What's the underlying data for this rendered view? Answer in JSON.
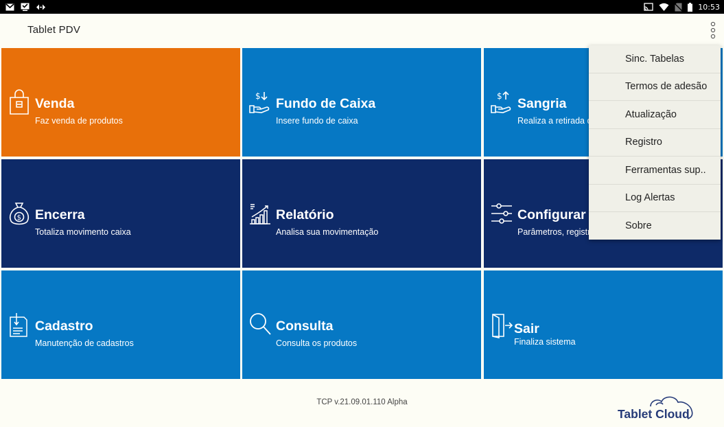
{
  "status_bar": {
    "left_icons": [
      "gmail-icon",
      "download-done-icon",
      "developer-mode-icon"
    ],
    "right_icons": [
      "cast-icon",
      "wifi-icon",
      "no-sim-icon",
      "battery-icon"
    ],
    "time": "10:53"
  },
  "app_bar": {
    "title": "Tablet PDV",
    "overflow_icon": "more-vertical-icon"
  },
  "tiles": [
    {
      "title": "Venda",
      "subtitle": "Faz venda de produtos",
      "color": "#e8700a",
      "icon": "shopping-bag-icon"
    },
    {
      "title": "Fundo de Caixa",
      "subtitle": "Insere fundo de caixa",
      "color": "#0678c4",
      "icon": "hand-money-in-icon"
    },
    {
      "title": "Sangria",
      "subtitle": "Realiza a retirada d",
      "color": "#0678c4",
      "icon": "hand-money-out-icon"
    },
    {
      "title": "Encerra",
      "subtitle": "Totaliza movimento caixa",
      "color": "#0e2a68",
      "icon": "money-bag-icon"
    },
    {
      "title": "Relatório",
      "subtitle": "Analisa sua movimentação",
      "color": "#0e2a68",
      "icon": "bar-chart-icon"
    },
    {
      "title": "Configurar",
      "subtitle": "Parâmetros, registr",
      "color": "#0e2a68",
      "icon": "sliders-icon"
    },
    {
      "title": "Cadastro",
      "subtitle": "Manutenção de cadastros",
      "color": "#0678c4",
      "icon": "document-icon"
    },
    {
      "title": "Consulta",
      "subtitle": "Consulta os produtos",
      "color": "#0678c4",
      "icon": "search-icon"
    },
    {
      "title": "Sair",
      "subtitle": "Finaliza sistema",
      "color": "#0678c4",
      "icon": "exit-door-icon"
    }
  ],
  "menu": {
    "items": [
      "Sinc. Tabelas",
      "Termos de adesão",
      "Atualização",
      "Registro",
      "Ferramentas sup..",
      "Log Alertas",
      "Sobre"
    ]
  },
  "footer": {
    "version": "TCP v.21.09.01.110 Alpha",
    "logo_text": "Tablet Cloud"
  }
}
